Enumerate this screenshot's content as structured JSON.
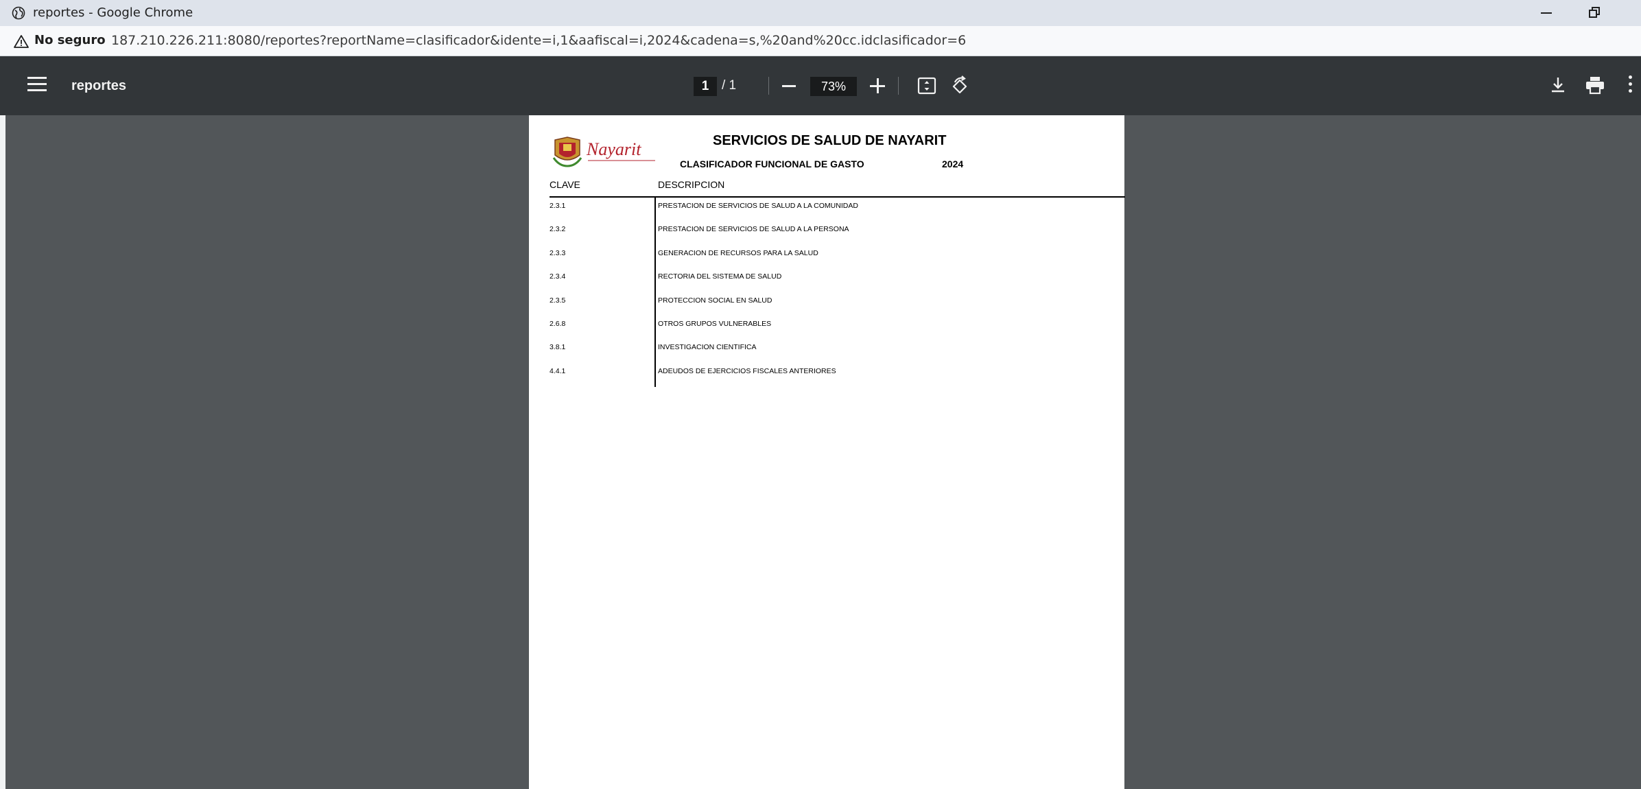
{
  "window": {
    "title": "reportes - Google Chrome"
  },
  "address": {
    "security_label": "No seguro",
    "url": "187.210.226.211:8080/reportes?reportName=clasificador&idente=i,1&aafiscal=i,2024&cadena=s,%20and%20cc.idclasificador=6"
  },
  "pdf_toolbar": {
    "title": "reportes",
    "current_page": "1",
    "total_pages": "/ 1",
    "zoom": "73%"
  },
  "document": {
    "title": "SERVICIOS DE SALUD DE NAYARIT",
    "subtitle": "CLASIFICADOR FUNCIONAL DE GASTO",
    "year": "2024",
    "logo_text": "Nayarit",
    "columns": {
      "clave": "CLAVE",
      "descripcion": "DESCRIPCION"
    },
    "rows": [
      {
        "clave": "2.3.1",
        "descripcion": "PRESTACION DE SERVICIOS DE SALUD A LA COMUNIDAD"
      },
      {
        "clave": "2.3.2",
        "descripcion": "PRESTACION DE SERVICIOS DE SALUD A LA PERSONA"
      },
      {
        "clave": "2.3.3",
        "descripcion": "GENERACION DE RECURSOS PARA LA SALUD"
      },
      {
        "clave": "2.3.4",
        "descripcion": "RECTORIA DEL SISTEMA DE SALUD"
      },
      {
        "clave": "2.3.5",
        "descripcion": "PROTECCION SOCIAL EN SALUD"
      },
      {
        "clave": "2.6.8",
        "descripcion": "OTROS GRUPOS VULNERABLES"
      },
      {
        "clave": "3.8.1",
        "descripcion": "INVESTIGACION CIENTIFICA"
      },
      {
        "clave": "4.4.1",
        "descripcion": "ADEUDOS DE EJERCICIOS FISCALES ANTERIORES"
      }
    ]
  },
  "colors": {
    "pdf_background": "#525659",
    "toolbar": "#323639",
    "titlebar": "#dee3eb",
    "logo_red": "#b3222c"
  }
}
